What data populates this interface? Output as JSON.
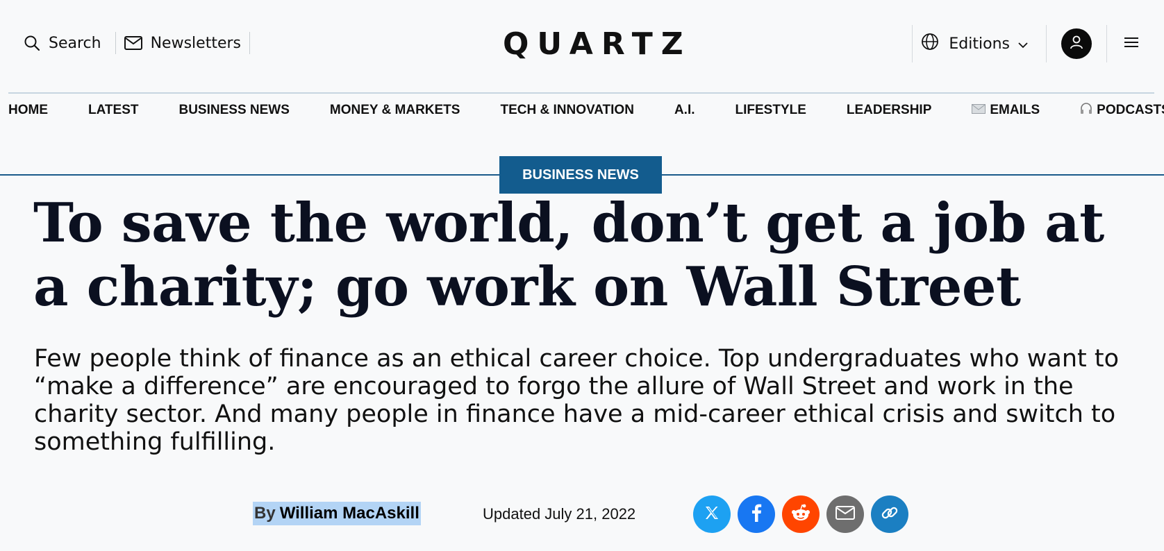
{
  "header": {
    "search_label": "Search",
    "newsletters_label": "Newsletters",
    "logo": "QUARTZ",
    "editions_label": "Editions"
  },
  "nav": {
    "items": [
      {
        "label": "HOME",
        "icon": ""
      },
      {
        "label": "LATEST",
        "icon": ""
      },
      {
        "label": "BUSINESS NEWS",
        "icon": ""
      },
      {
        "label": "MONEY & MARKETS",
        "icon": ""
      },
      {
        "label": "TECH & INNOVATION",
        "icon": ""
      },
      {
        "label": "A.I.",
        "icon": ""
      },
      {
        "label": "LIFESTYLE",
        "icon": ""
      },
      {
        "label": "LEADERSHIP",
        "icon": ""
      },
      {
        "label": "EMAILS",
        "icon": "envelope-icon"
      },
      {
        "label": "PODCASTS",
        "icon": "headphones-icon"
      }
    ]
  },
  "article": {
    "category": "BUSINESS NEWS",
    "headline": "To save the world, don’t get a job at a charity; go work on Wall Street",
    "dek": "Few people think of finance as an ethical career choice. Top undergraduates who want to “make a difference” are encouraged to forgo the allure of Wall Street and work in the charity sector. And many people in finance have a mid-career ethical crisis and switch to something fulfilling.",
    "byline_prefix": "By",
    "author": "William MacAskill",
    "updated": "Updated July 21, 2022"
  },
  "share": [
    {
      "name": "x-share",
      "icon": "x-icon",
      "color": "#1da1f2"
    },
    {
      "name": "facebook-share",
      "icon": "facebook-icon",
      "color": "#1877f2"
    },
    {
      "name": "reddit-share",
      "icon": "reddit-icon",
      "color": "#ff4500"
    },
    {
      "name": "email-share",
      "icon": "email-icon",
      "color": "#6e6e6e"
    },
    {
      "name": "copy-link-share",
      "icon": "link-icon",
      "color": "#1b7fc2"
    }
  ],
  "colors": {
    "accent": "#135c8e",
    "background": "#f8f9fa"
  }
}
